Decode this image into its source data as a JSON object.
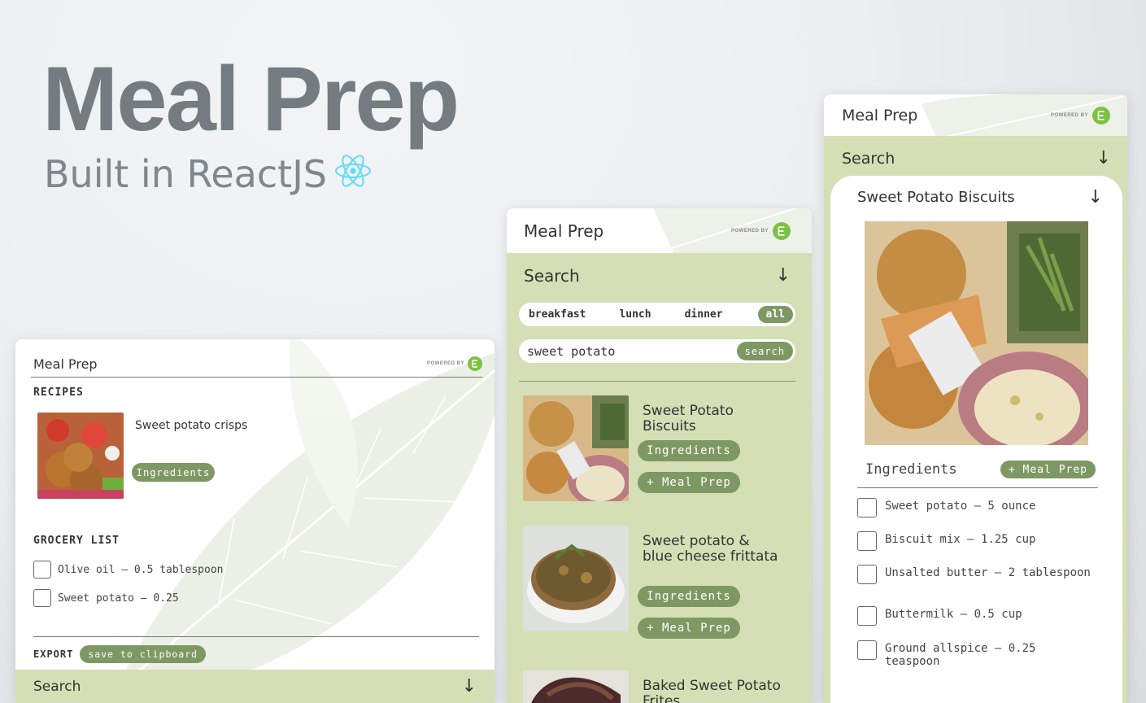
{
  "hero": {
    "title": "Meal Prep",
    "subtitle": "Built in ReactJS",
    "icon": "react-icon"
  },
  "colors": {
    "accent_green": "#7e9863",
    "panel_green": "#d4dfb5",
    "logo_green": "#7cc242",
    "hero_text": "#747c82"
  },
  "common": {
    "app_name": "Meal Prep",
    "powered_by": "POWERED BY",
    "search_label": "Search",
    "arrow": "↓",
    "ingredients_label": "Ingredients",
    "meal_prep_button": "+ Meal Prep"
  },
  "left_panel": {
    "recipes_heading": "RECIPES",
    "recipe_name": "Sweet potato crisps",
    "grocery_heading": "GROCERY LIST",
    "grocery_items": [
      "Olive oil – 0.5 tablespoon",
      "Sweet potato – 0.25"
    ],
    "export_label": "EXPORT",
    "clipboard_button": "save to clipboard"
  },
  "middle_panel": {
    "filters": [
      "breakfast",
      "lunch",
      "dinner",
      "all"
    ],
    "active_filter": "all",
    "query_value": "sweet potato",
    "search_button": "search",
    "results": [
      {
        "title": "Sweet Potato Biscuits"
      },
      {
        "title": "Sweet potato & blue cheese frittata"
      },
      {
        "title": "Baked Sweet Potato Frites"
      }
    ]
  },
  "right_panel": {
    "recipe_title": "Sweet Potato Biscuits",
    "ingredients": [
      "Sweet potato – 5 ounce",
      "Biscuit mix – 1.25 cup",
      "Unsalted butter – 2 tablespoon",
      "Buttermilk – 0.5 cup",
      "Ground allspice – 0.25 teaspoon"
    ]
  }
}
